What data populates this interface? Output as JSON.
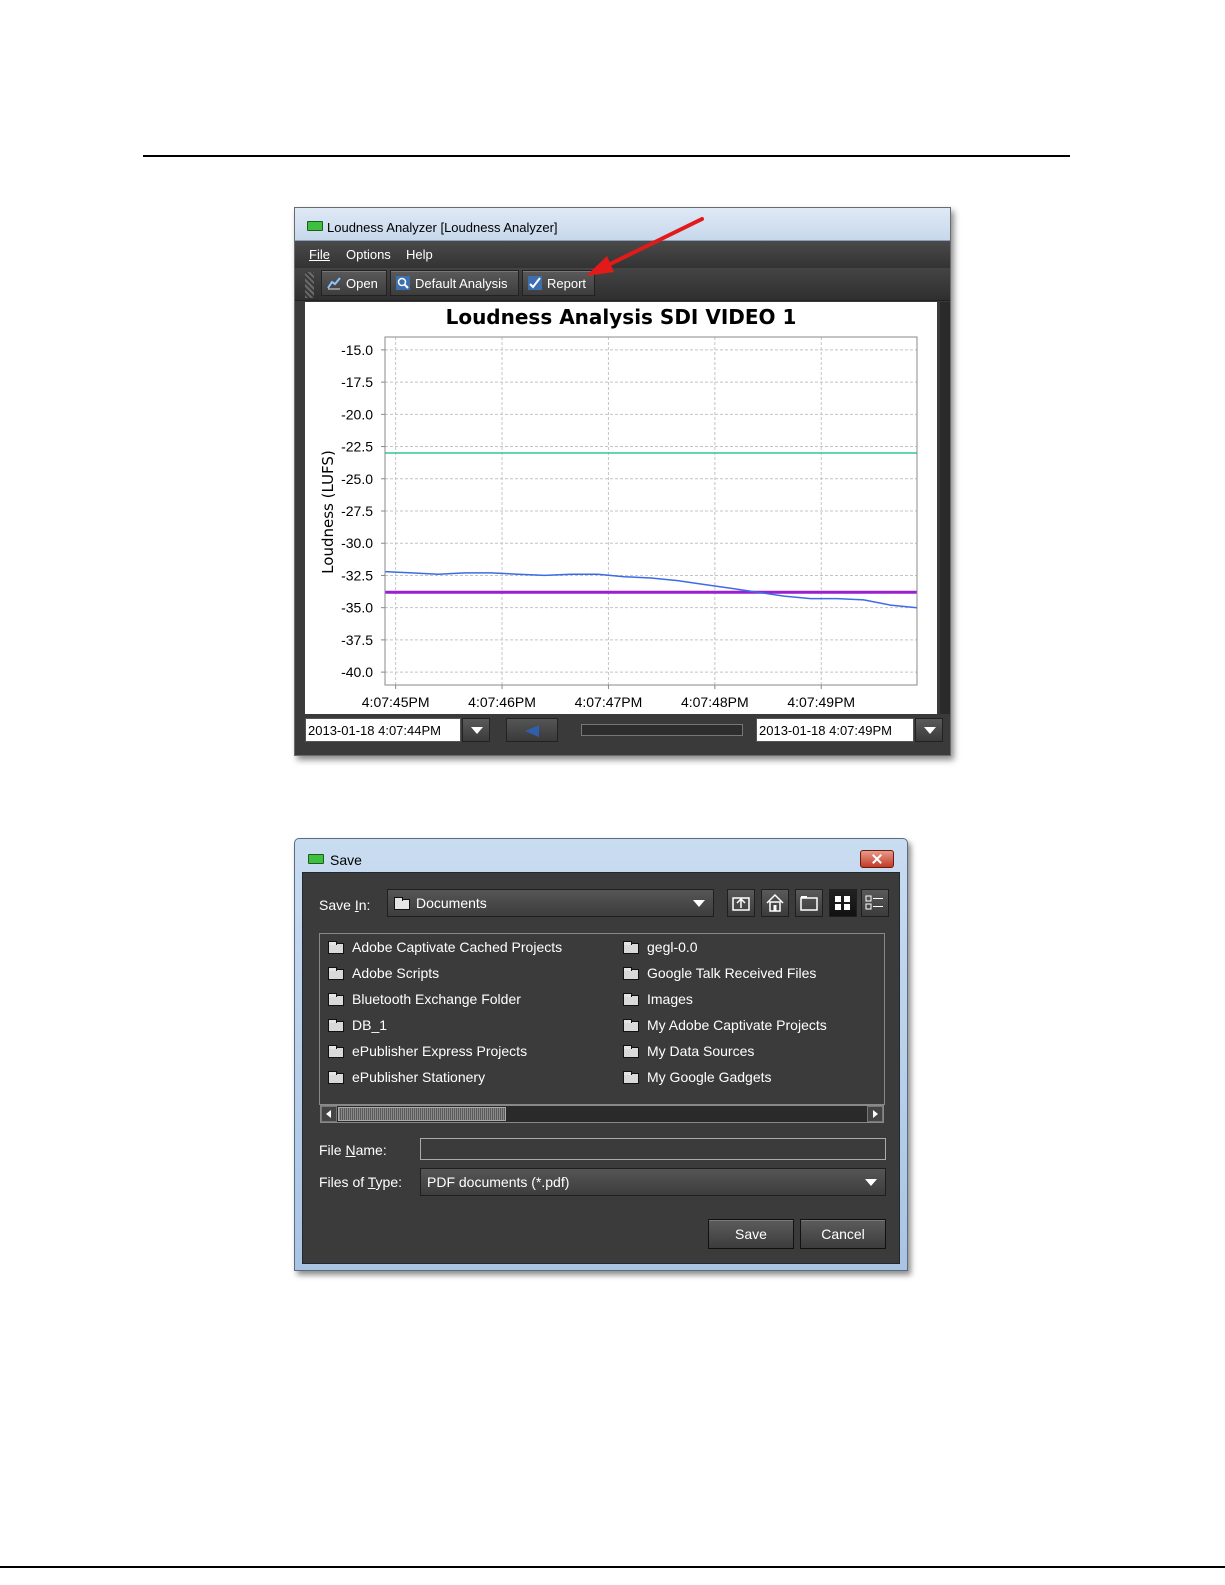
{
  "analyzer": {
    "title": "Loudness Analyzer [Loudness Analyzer]",
    "menu": {
      "file": "File",
      "options": "Options",
      "help": "Help"
    },
    "toolbar": {
      "open": "Open",
      "default_analysis": "Default Analysis",
      "report": "Report"
    },
    "start_time": "2013-01-18 4:07:44PM",
    "end_time": "2013-01-18 4:07:49PM"
  },
  "chart_data": {
    "type": "line",
    "title": "Loudness Analysis SDI VIDEO 1",
    "ylabel": "Loudness (LUFS)",
    "xlabel": "",
    "ylim": [
      -41.0,
      -14.0
    ],
    "xlim": [
      0,
      5.0
    ],
    "yticks": [
      -15.0,
      -17.5,
      -20.0,
      -22.5,
      -25.0,
      -27.5,
      -30.0,
      -32.5,
      -35.0,
      -37.5,
      -40.0
    ],
    "xticks": [
      {
        "x": 0.1,
        "label": "4:07:45PM"
      },
      {
        "x": 1.1,
        "label": "4:07:46PM"
      },
      {
        "x": 2.1,
        "label": "4:07:47PM"
      },
      {
        "x": 3.1,
        "label": "4:07:48PM"
      },
      {
        "x": 4.1,
        "label": "4:07:49PM"
      }
    ],
    "grid": true,
    "reference_lines": [
      {
        "value": -23.0,
        "color": "#2fc89a"
      },
      {
        "value": -33.8,
        "color": "#9a1fd1"
      }
    ],
    "series": [
      {
        "color": "#3b6be8",
        "x": [
          0,
          0.25,
          0.5,
          0.75,
          1.0,
          1.25,
          1.5,
          1.75,
          2.0,
          2.25,
          2.5,
          2.75,
          3.0,
          3.25,
          3.5,
          3.75,
          4.0,
          4.25,
          4.5,
          4.75,
          5.0
        ],
        "y": [
          -32.2,
          -32.3,
          -32.4,
          -32.3,
          -32.3,
          -32.4,
          -32.5,
          -32.4,
          -32.4,
          -32.6,
          -32.7,
          -32.9,
          -33.2,
          -33.5,
          -33.8,
          -34.1,
          -34.3,
          -34.3,
          -34.4,
          -34.8,
          -35.0
        ]
      }
    ]
  },
  "save_dialog": {
    "title": "Save",
    "save_in_label": "Save In:",
    "save_in_value": "Documents",
    "files": [
      "Adobe Captivate Cached Projects",
      "Adobe Scripts",
      "Bluetooth Exchange Folder",
      "DB_1",
      "ePublisher Express Projects",
      "ePublisher Stationery",
      "gegl-0.0",
      "Google Talk Received Files",
      "Images",
      "My Adobe Captivate Projects",
      "My Data Sources",
      "My Google Gadgets"
    ],
    "file_name_label": "File Name:",
    "file_name_value": "",
    "files_of_type_label": "Files of Type:",
    "files_of_type_value": "PDF documents (*.pdf)",
    "save_button": "Save",
    "cancel_button": "Cancel"
  },
  "colors": {
    "arrow": "#e21a1a",
    "app_icon": "#3fbf3f"
  }
}
